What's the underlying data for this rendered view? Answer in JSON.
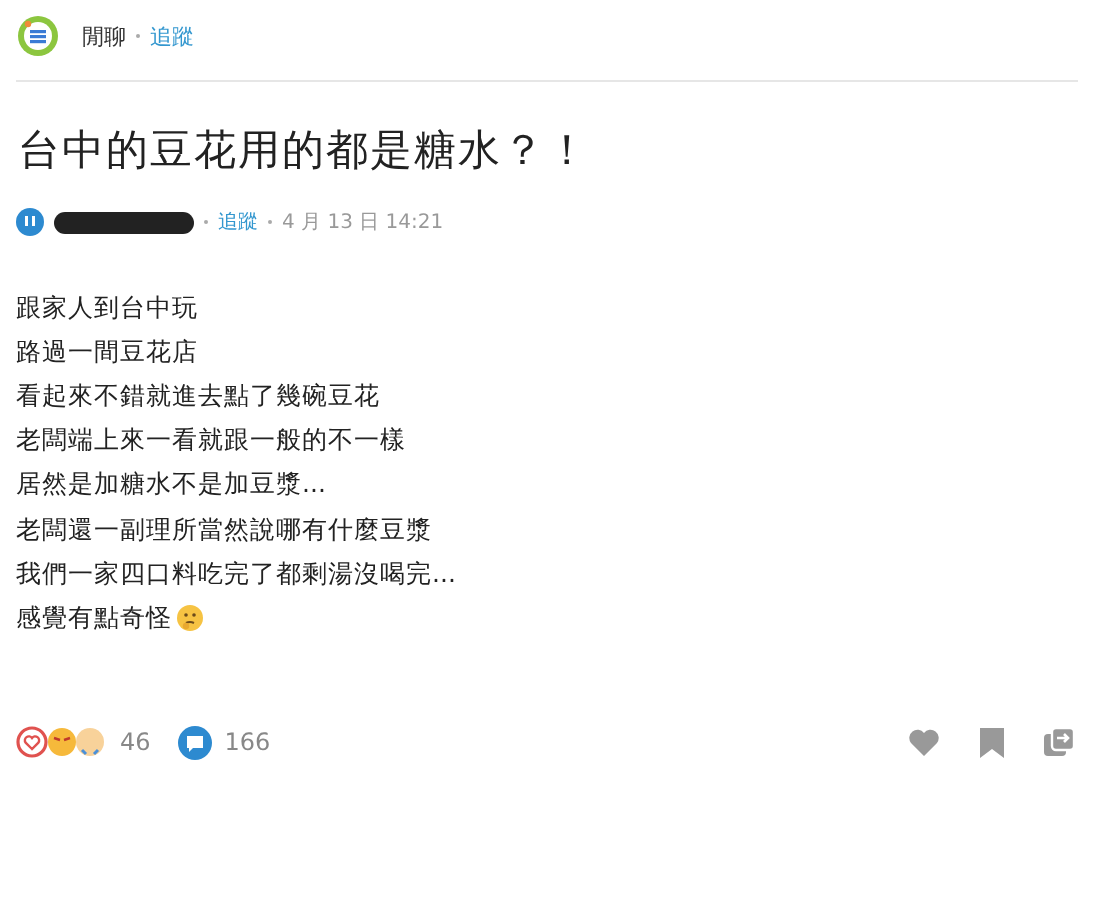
{
  "board": {
    "name": "閒聊",
    "follow": "追蹤"
  },
  "title": "台中的豆花用的都是糖水？！",
  "meta": {
    "follow": "追蹤",
    "time": "4 月 13 日 14:21"
  },
  "body": [
    "跟家人到台中玩",
    "路過一間豆花店",
    "看起來不錯就進去點了幾碗豆花",
    "老闆端上來一看就跟一般的不一樣",
    "居然是加糖水不是加豆漿...",
    "老闆還一副理所當然說哪有什麼豆漿",
    "我們一家四口料吃完了都剩湯沒喝完...",
    "感覺有點奇怪"
  ],
  "reactions": {
    "count": "46"
  },
  "comments": {
    "count": "166"
  }
}
